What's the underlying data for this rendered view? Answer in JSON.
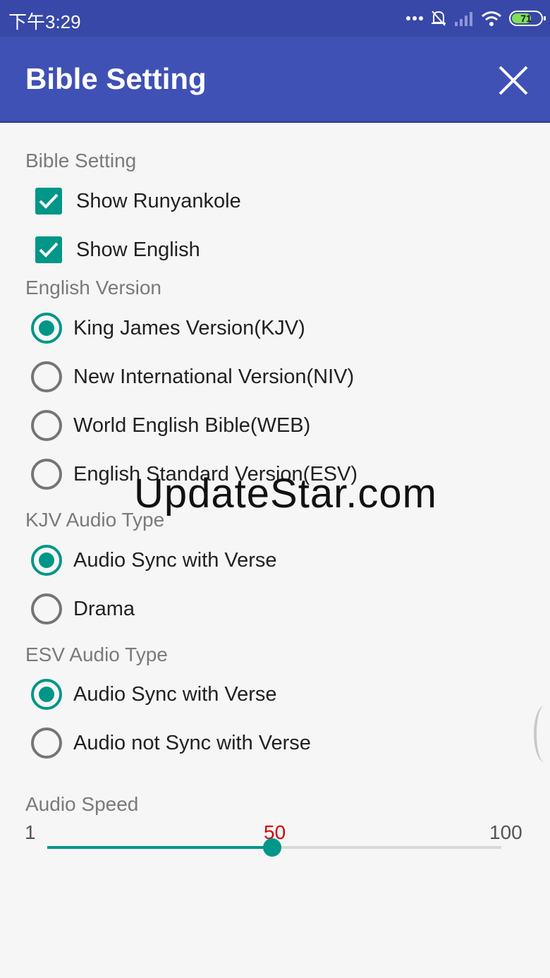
{
  "status_bar": {
    "time": "下午3:29",
    "battery": "71",
    "battery_level": 0.71
  },
  "app_bar": {
    "title": "Bible Setting",
    "close_icon": "close-icon"
  },
  "sections": {
    "bible_setting": {
      "label": "Bible Setting",
      "options": [
        {
          "label": "Show Runyankole",
          "checked": true
        },
        {
          "label": "Show English",
          "checked": true
        }
      ]
    },
    "english_version": {
      "label": "English Version",
      "options": [
        {
          "label": "King James Version(KJV)",
          "selected": true
        },
        {
          "label": "New International Version(NIV)",
          "selected": false
        },
        {
          "label": "World English Bible(WEB)",
          "selected": false
        },
        {
          "label": "English Standard Version(ESV)",
          "selected": false
        }
      ]
    },
    "kjv_audio": {
      "label": "KJV Audio Type",
      "options": [
        {
          "label": "Audio Sync with Verse",
          "selected": true
        },
        {
          "label": "Drama",
          "selected": false
        }
      ]
    },
    "esv_audio": {
      "label": "ESV Audio Type",
      "options": [
        {
          "label": "Audio Sync with Verse",
          "selected": true
        },
        {
          "label": "Audio not Sync with Verse",
          "selected": false
        }
      ]
    },
    "audio_speed": {
      "label": "Audio Speed",
      "min": "1",
      "max": "100",
      "value": "50"
    }
  },
  "colors": {
    "primary": "#3f51b5",
    "status_bar": "#3848a8",
    "accent": "#009688",
    "value_text": "#d50000"
  },
  "watermark": "UpdateStar.com"
}
